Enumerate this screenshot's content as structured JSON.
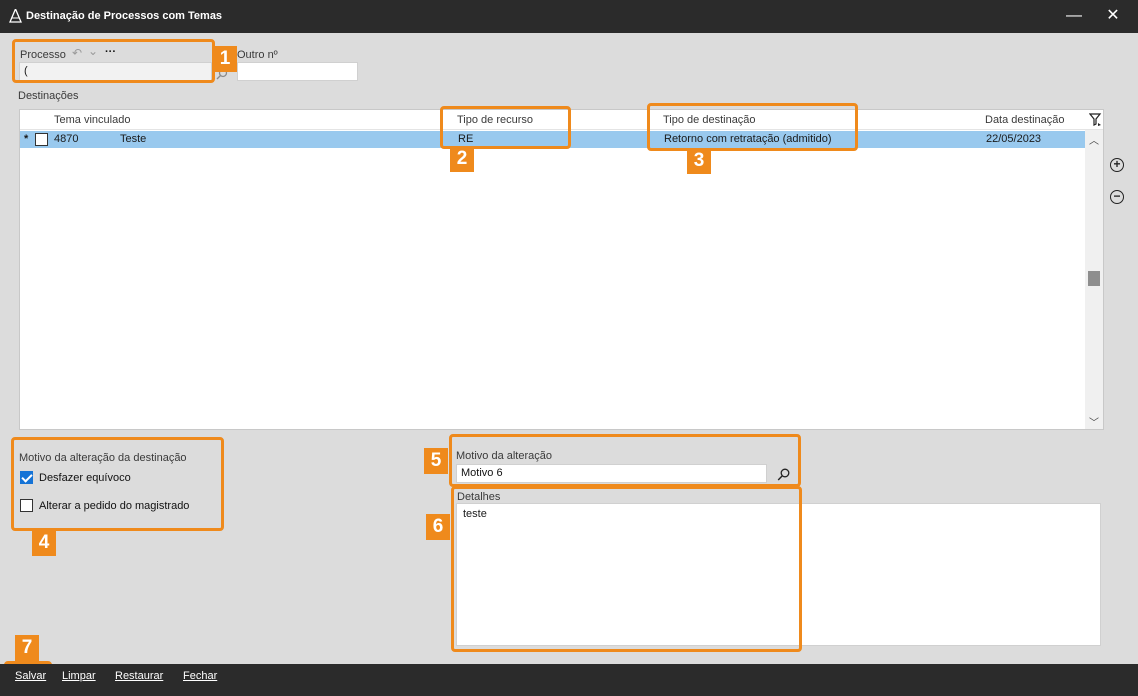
{
  "window": {
    "title": "Destinação de Processos com Temas",
    "minimize_glyph": "—",
    "close_glyph": "✕"
  },
  "processo": {
    "label": "Processo",
    "undo_glyph": "↶",
    "chevron_glyph": "⌄",
    "more_glyph": "···",
    "value": "("
  },
  "outro": {
    "label": "Outro nº",
    "value": ""
  },
  "destinacoes": {
    "label": "Destinações",
    "columns": [
      "Tema vinculado",
      "Tipo de recurso",
      "Tipo de destinação",
      "Data destinação"
    ],
    "rows": [
      {
        "marker": "*",
        "tema_numero": "4870",
        "tema_nome": "Teste",
        "tipo_recurso": "RE",
        "tipo_destinacao": "Retorno com retratação (admitido)",
        "data": "22/05/2023"
      }
    ]
  },
  "motivo_group": {
    "label": "Motivo da alteração da destinação",
    "option1": "Desfazer equívoco",
    "option1_checked": true,
    "option2": "Alterar a pedido do magistrado",
    "option2_checked": false
  },
  "motivo_alteracao": {
    "label": "Motivo da alteração",
    "value": "Motivo 6"
  },
  "detalhes": {
    "label": "Detalhes",
    "value": "teste"
  },
  "side_buttons": {
    "add_glyph": "+",
    "remove_glyph": "−"
  },
  "footer": {
    "save": "Salvar",
    "clear": "Limpar",
    "restore": "Restaurar",
    "close": "Fechar"
  },
  "badges": [
    "1",
    "2",
    "3",
    "4",
    "5",
    "6",
    "7"
  ],
  "colors": {
    "highlight": "#ef8a1c",
    "selected_row": "#99c9ee",
    "titlebar": "#2b2b2b",
    "checkbox_checked": "#1573d6"
  }
}
